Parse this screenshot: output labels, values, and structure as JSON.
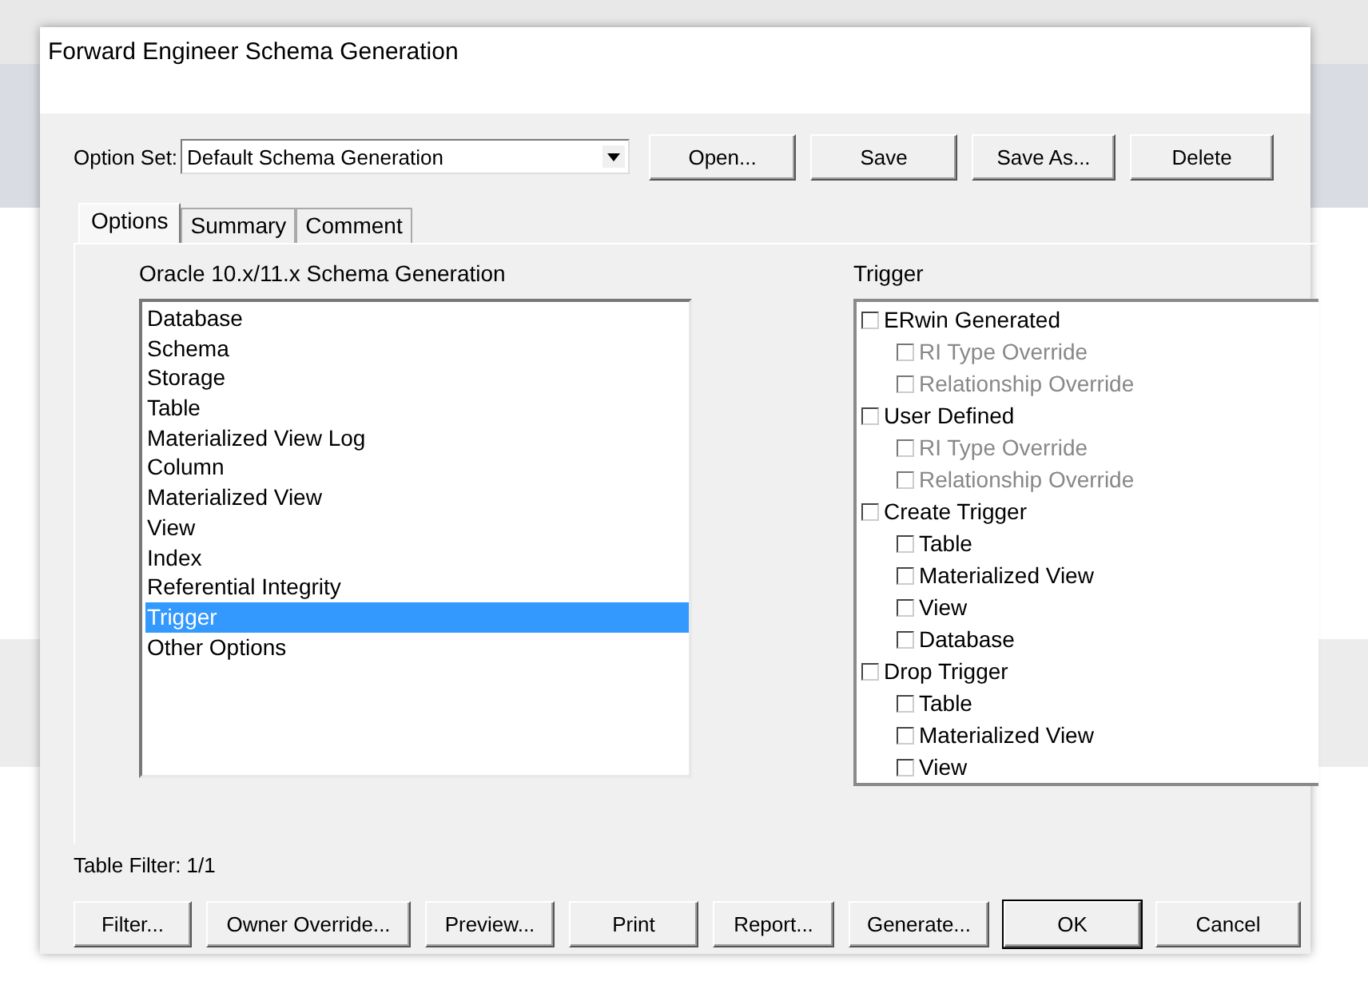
{
  "window": {
    "title": "Forward Engineer Schema Generation"
  },
  "option_set": {
    "label": "Option Set:",
    "value": "Default Schema Generation"
  },
  "top_buttons": [
    "Open...",
    "Save",
    "Save As...",
    "Delete"
  ],
  "tabs": [
    {
      "label": "Options",
      "selected": true
    },
    {
      "label": "Summary",
      "selected": false
    },
    {
      "label": "Comment",
      "selected": false
    }
  ],
  "categories": {
    "title": "Oracle 10.x/11.x Schema Generation",
    "items": [
      {
        "label": "Database",
        "selected": false
      },
      {
        "label": "Schema",
        "selected": false
      },
      {
        "label": "Storage",
        "selected": false
      },
      {
        "label": "Table",
        "selected": false
      },
      {
        "label": "Materialized View Log",
        "selected": false
      },
      {
        "label": "Column",
        "selected": false
      },
      {
        "label": "Materialized View",
        "selected": false
      },
      {
        "label": "View",
        "selected": false
      },
      {
        "label": "Index",
        "selected": false
      },
      {
        "label": "Referential Integrity",
        "selected": false
      },
      {
        "label": "Trigger",
        "selected": true
      },
      {
        "label": "Other Options",
        "selected": false
      }
    ]
  },
  "options": {
    "title": "Trigger",
    "items": [
      {
        "label": "ERwin Generated",
        "checked": false,
        "disabled": false,
        "children": [
          {
            "label": "RI Type Override",
            "checked": false,
            "disabled": true
          },
          {
            "label": "Relationship Override",
            "checked": false,
            "disabled": true
          }
        ]
      },
      {
        "label": "User Defined",
        "checked": false,
        "disabled": false,
        "children": [
          {
            "label": "RI Type Override",
            "checked": false,
            "disabled": true
          },
          {
            "label": "Relationship Override",
            "checked": false,
            "disabled": true
          }
        ]
      },
      {
        "label": "Create Trigger",
        "checked": false,
        "disabled": false,
        "children": [
          {
            "label": "Table",
            "checked": false,
            "disabled": false
          },
          {
            "label": "Materialized View",
            "checked": false,
            "disabled": false
          },
          {
            "label": "View",
            "checked": false,
            "disabled": false
          },
          {
            "label": "Database",
            "checked": false,
            "disabled": false
          }
        ]
      },
      {
        "label": "Drop Trigger",
        "checked": false,
        "disabled": false,
        "children": [
          {
            "label": "Table",
            "checked": false,
            "disabled": false
          },
          {
            "label": "Materialized View",
            "checked": false,
            "disabled": false
          },
          {
            "label": "View",
            "checked": false,
            "disabled": false
          }
        ]
      }
    ]
  },
  "status": "Table Filter: 1/1",
  "bottom_buttons": [
    {
      "label": "Filter...",
      "default": false
    },
    {
      "label": "Owner Override...",
      "default": false
    },
    {
      "label": "Preview...",
      "default": false
    },
    {
      "label": "Print",
      "default": false
    },
    {
      "label": "Report...",
      "default": false
    },
    {
      "label": "Generate...",
      "default": false
    },
    {
      "label": "OK",
      "default": true
    },
    {
      "label": "Cancel",
      "default": false
    }
  ]
}
